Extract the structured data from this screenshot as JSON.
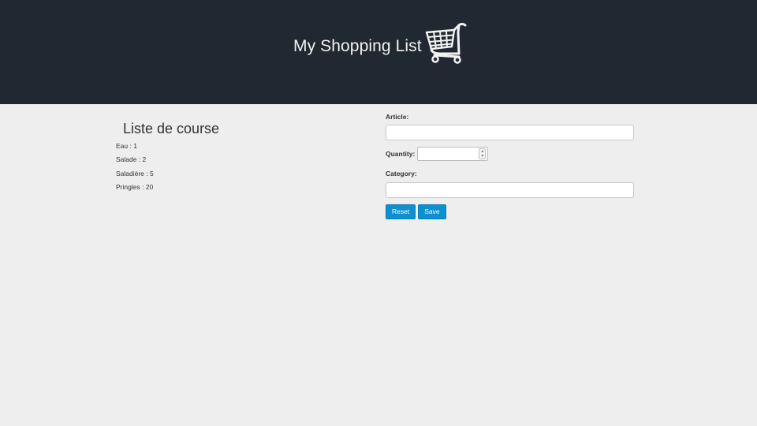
{
  "header": {
    "title": "My Shopping List",
    "logo_icon": "shopping-cart-icon",
    "background": "#222831"
  },
  "list": {
    "title": "Liste de course",
    "items": [
      {
        "text": "Eau : 1"
      },
      {
        "text": "Salade : 2"
      },
      {
        "text": "Saladière : 5"
      },
      {
        "text": "Pringles : 20"
      }
    ]
  },
  "form": {
    "article_label": "Article:",
    "article_value": "",
    "quantity_label": "Quantity:",
    "quantity_value": "",
    "category_label": "Category:",
    "category_value": "",
    "reset_label": "Reset",
    "save_label": "Save",
    "button_color": "#0d8fd0"
  }
}
